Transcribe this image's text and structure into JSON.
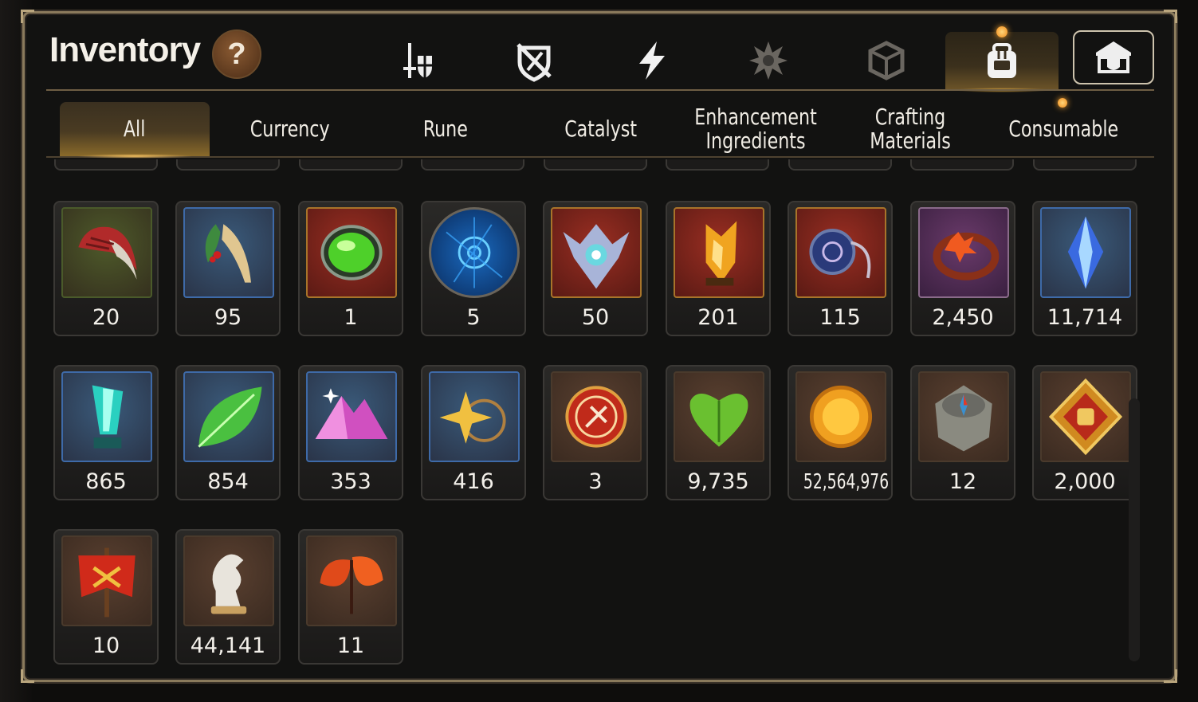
{
  "title": "Inventory",
  "help_label": "?",
  "category_tabs": [
    {
      "icon": "sword-shield-icon",
      "active": false
    },
    {
      "icon": "broken-shield-icon",
      "active": false
    },
    {
      "icon": "lightning-icon",
      "active": false
    },
    {
      "icon": "spiked-emblem-icon",
      "active": false
    },
    {
      "icon": "cube-icon",
      "active": false
    },
    {
      "icon": "backpack-icon",
      "active": true
    },
    {
      "icon": "guild-hall-icon",
      "active": false
    }
  ],
  "sub_tabs": [
    {
      "label": "All",
      "active": true
    },
    {
      "label": "Currency",
      "active": false
    },
    {
      "label": "Rune",
      "active": false
    },
    {
      "label": "Catalyst",
      "active": false
    },
    {
      "label": "Enhancement Ingredients",
      "active": false
    },
    {
      "label": "Crafting Materials",
      "active": false
    },
    {
      "label": "Consumable",
      "active": false
    }
  ],
  "items": [
    {
      "icon": "red-claw-icon",
      "qty": "20",
      "bg": "green"
    },
    {
      "icon": "herb-root-icon",
      "qty": "95",
      "bg": "blue"
    },
    {
      "icon": "green-gem-icon",
      "qty": "1",
      "bg": "red"
    },
    {
      "icon": "blue-rune-disc-icon",
      "qty": "5",
      "bg": "round"
    },
    {
      "icon": "winged-eye-icon",
      "qty": "50",
      "bg": "red"
    },
    {
      "icon": "amber-crystal-icon",
      "qty": "201",
      "bg": "red"
    },
    {
      "icon": "cosmic-amulet-icon",
      "qty": "115",
      "bg": "red"
    },
    {
      "icon": "flower-ring-icon",
      "qty": "2,450",
      "bg": "purple"
    },
    {
      "icon": "blue-diamond-icon",
      "qty": "11,714",
      "bg": "blue"
    },
    {
      "icon": "teal-crystal-icon",
      "qty": "865",
      "bg": "blue"
    },
    {
      "icon": "green-leaf-icon",
      "qty": "854",
      "bg": "blue"
    },
    {
      "icon": "pink-mountain-icon",
      "qty": "353",
      "bg": "blue"
    },
    {
      "icon": "star-pendant-icon",
      "qty": "416",
      "bg": "blue"
    },
    {
      "icon": "red-seal-icon",
      "qty": "3",
      "bg": "brown"
    },
    {
      "icon": "green-heart-icon",
      "qty": "9,735",
      "bg": "brown"
    },
    {
      "icon": "sun-coin-icon",
      "qty": "52,564,976",
      "bg": "brown"
    },
    {
      "icon": "stone-compass-icon",
      "qty": "12",
      "bg": "brown"
    },
    {
      "icon": "fist-badge-icon",
      "qty": "2,000",
      "bg": "brown"
    },
    {
      "icon": "war-banner-icon",
      "qty": "10",
      "bg": "brown"
    },
    {
      "icon": "silver-knight-icon",
      "qty": "44,141",
      "bg": "brown"
    },
    {
      "icon": "flame-leaf-icon",
      "qty": "11",
      "bg": "brown"
    }
  ]
}
